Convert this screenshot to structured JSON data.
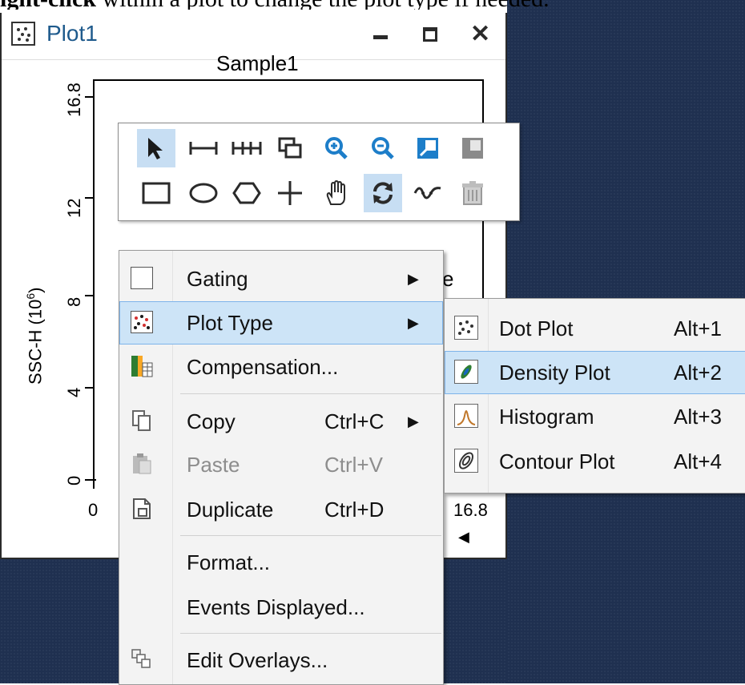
{
  "instruction": {
    "bold": "ight-click",
    "rest": " within a plot to change the plot type if needed."
  },
  "window": {
    "title": "Plot1",
    "buttons": [
      "minimize",
      "maximize",
      "close"
    ]
  },
  "plot": {
    "sample_title": "Sample1",
    "y_axis_label": "SSC-H (10",
    "y_axis_exponent": "6",
    "y_axis_suffix": ")",
    "y_ticks": [
      "0",
      "4",
      "8",
      "12",
      "16.8"
    ],
    "x_ticks": [
      "0",
      "16.8"
    ],
    "partial_text": "e"
  },
  "toolbar": {
    "row1": [
      "pointer-icon",
      "range-gate-icon",
      "multi-range-gate-icon",
      "overlay-icon",
      "zoom-in-icon",
      "zoom-out-icon",
      "fit-icon",
      "restore-icon"
    ],
    "row2": [
      "rectangle-gate-icon",
      "ellipse-gate-icon",
      "polygon-gate-icon",
      "quadrant-gate-icon",
      "pan-hand-icon",
      "rotate-icon",
      "spline-gate-icon",
      "delete-gate-icon"
    ],
    "selected": [
      "pointer-icon",
      "rotate-icon"
    ]
  },
  "context_menu": {
    "items": [
      {
        "label": "Gating",
        "shortcut": "",
        "submenu": true,
        "icon": "gating-icon"
      },
      {
        "label": "Plot Type",
        "shortcut": "",
        "submenu": true,
        "icon": "plot-type-icon"
      },
      {
        "label": "Compensation...",
        "shortcut": "",
        "submenu": false,
        "icon": "compensation-icon"
      },
      {
        "label": "Copy",
        "shortcut": "Ctrl+C",
        "submenu": true,
        "icon": "copy-icon"
      },
      {
        "label": "Paste",
        "shortcut": "Ctrl+V",
        "submenu": false,
        "icon": "paste-icon",
        "disabled": true
      },
      {
        "label": "Duplicate",
        "shortcut": "Ctrl+D",
        "submenu": false,
        "icon": "duplicate-icon"
      },
      {
        "label": "Format...",
        "shortcut": "",
        "submenu": false,
        "icon": ""
      },
      {
        "label": "Events Displayed...",
        "shortcut": "",
        "submenu": false,
        "icon": ""
      },
      {
        "label": "Edit Overlays...",
        "shortcut": "",
        "submenu": false,
        "icon": "edit-overlays-icon"
      }
    ],
    "highlighted": "Plot Type"
  },
  "submenu": {
    "items": [
      {
        "label": "Dot Plot",
        "shortcut": "Alt+1",
        "icon": "dot-plot-icon"
      },
      {
        "label": "Density Plot",
        "shortcut": "Alt+2",
        "icon": "density-plot-icon"
      },
      {
        "label": "Histogram",
        "shortcut": "Alt+3",
        "icon": "histogram-icon"
      },
      {
        "label": "Contour Plot",
        "shortcut": "Alt+4",
        "icon": "contour-plot-icon"
      }
    ],
    "highlighted": "Density Plot"
  },
  "colors": {
    "background": "#1f3050",
    "menu_highlight": "#cde4f7",
    "menu_highlight_border": "#7eb4ea",
    "tool_selected": "#c7def3",
    "title_text": "#1e5a8c"
  }
}
